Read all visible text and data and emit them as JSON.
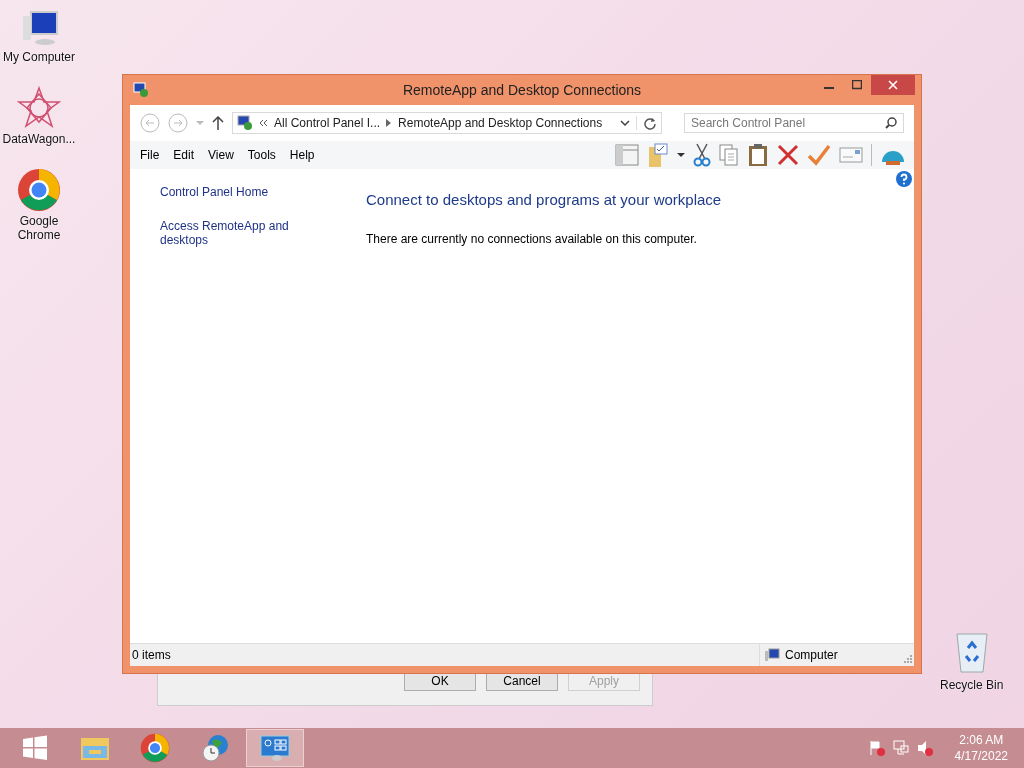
{
  "desktop_icons": [
    {
      "kind": "computer",
      "label": "My Computer"
    },
    {
      "kind": "star",
      "label": "DataWagon..."
    },
    {
      "kind": "chrome",
      "label": "Google Chrome"
    }
  ],
  "recycle_bin": {
    "label": "Recycle Bin"
  },
  "background_dialog": {
    "buttons": [
      {
        "label": "OK",
        "disabled": false
      },
      {
        "label": "Cancel",
        "disabled": false
      },
      {
        "label": "Apply",
        "disabled": true
      }
    ]
  },
  "window": {
    "title": "RemoteApp and Desktop Connections",
    "address": {
      "crumbs": [
        "All Control Panel I...",
        "RemoteApp and Desktop Connections"
      ]
    },
    "search": {
      "placeholder": "Search Control Panel"
    },
    "menu": [
      "File",
      "Edit",
      "View",
      "Tools",
      "Help"
    ],
    "sidebar": {
      "items": [
        "Control Panel Home",
        "Access RemoteApp and desktops"
      ]
    },
    "heading": "Connect to desktops and programs at your workplace",
    "message": "There are currently no connections available on this computer.",
    "status_bar": {
      "items": "0 items",
      "location": "Computer"
    }
  },
  "taskbar": {
    "items": [
      {
        "kind": "start",
        "selected": false
      },
      {
        "kind": "explorer",
        "selected": false
      },
      {
        "kind": "chrome",
        "selected": false
      },
      {
        "kind": "globe-clock",
        "selected": false
      },
      {
        "kind": "control-panel",
        "selected": true
      }
    ],
    "clock": {
      "time": "2:06 AM",
      "date": "4/17/2022"
    }
  }
}
